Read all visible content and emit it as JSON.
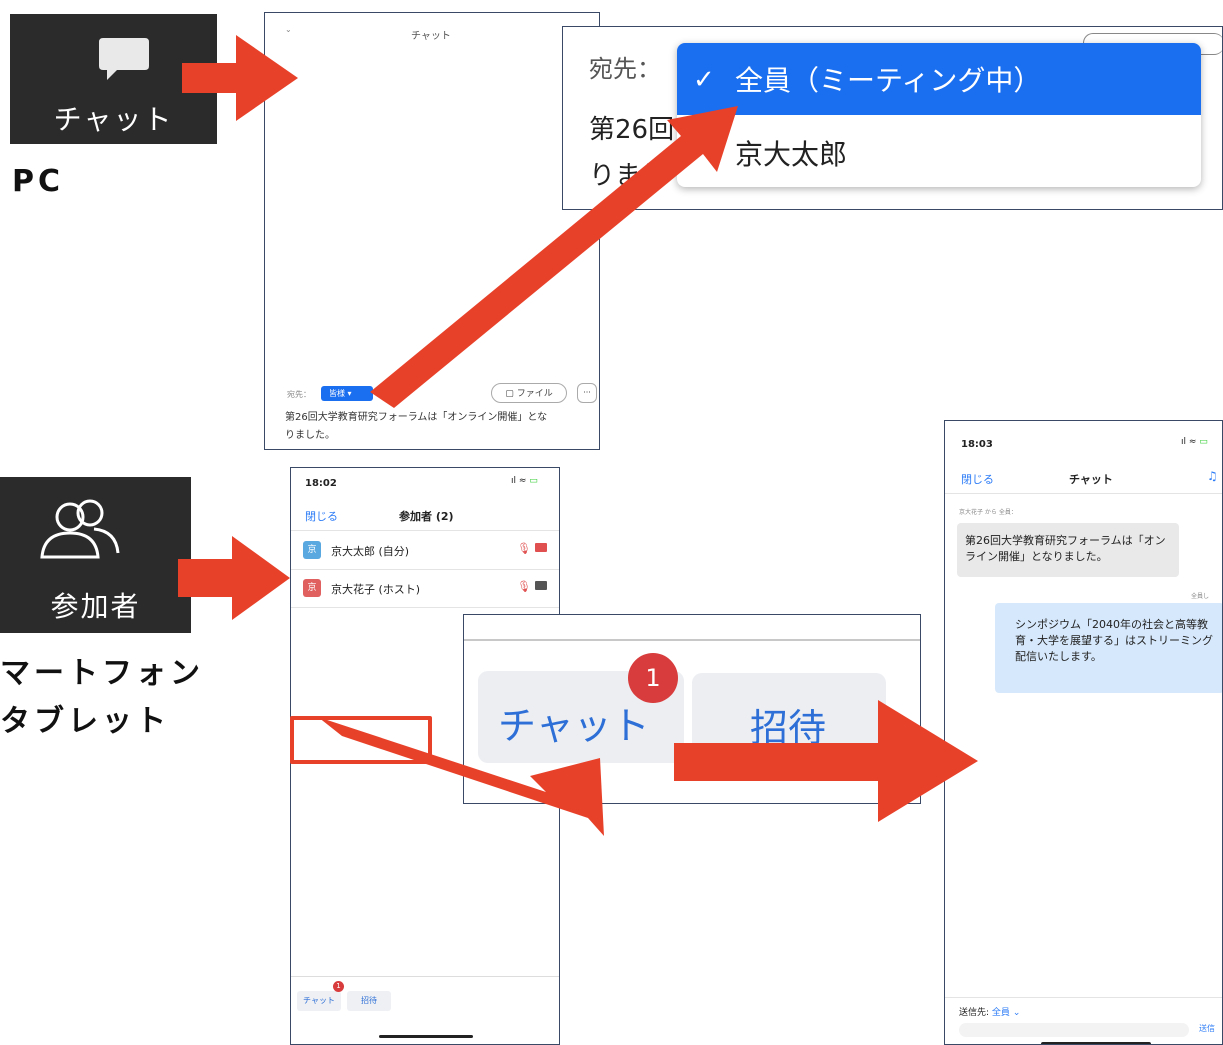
{
  "pc_section": {
    "chat_button_label": "チャット",
    "label": "PC",
    "chat_window": {
      "title": "チャット",
      "recipient_prefix": "宛先：",
      "recipient_value": "皆様",
      "file_button": "ファイル",
      "more_button": "···",
      "message_line1": "第26回大学教育研究フォーラムは「オンライン開催」とな",
      "message_line2": "りました。"
    },
    "zoom_callout": {
      "recipient_prefix": "宛先：",
      "option_everyone": "全員（ミーティング中）",
      "option_person": "京大太郎",
      "behind_line1": "第26回",
      "behind_line2": "りまし",
      "check_mark": "✓"
    }
  },
  "mobile_section": {
    "participants_button_label": "参加者",
    "label_line1": "マートフォン",
    "label_line2": "タブレット",
    "participants_screen": {
      "time": "18:02",
      "close": "閉じる",
      "title": "参加者 (2)",
      "participants": [
        {
          "avatar": "京",
          "name": "京大太郎 (自分)",
          "color": "#5aa8e0"
        },
        {
          "avatar": "京",
          "name": "京大花子 (ホスト)",
          "color": "#e06060"
        }
      ],
      "bottom_chat": "チャット",
      "bottom_invite": "招待",
      "badge": "1"
    },
    "zoom_callout": {
      "chat": "チャット",
      "invite": "招待",
      "badge": "1"
    },
    "chat_screen": {
      "time": "18:03",
      "close": "閉じる",
      "title": "チャット",
      "sender_line": "京大花子 から 全員：",
      "msg1_line1": "第26回大学教育研究フォーラムは「オン",
      "msg1_line2": "ライン開催」となりました。",
      "me_line": "全員し",
      "msg2_line1": "シンポジウム「2040年の社会と高等教",
      "msg2_line2": "育・大学を展望する」はストリーミング",
      "msg2_line3": "配信いたします。",
      "send_to_prefix": "送信先:",
      "send_to_value": "全員",
      "send_button": "送信"
    }
  },
  "colors": {
    "arrow": "#e8412a",
    "zoom_blue": "#1a6ef0",
    "panel_border": "#3a4a66",
    "badge_red": "#d83c3c"
  }
}
